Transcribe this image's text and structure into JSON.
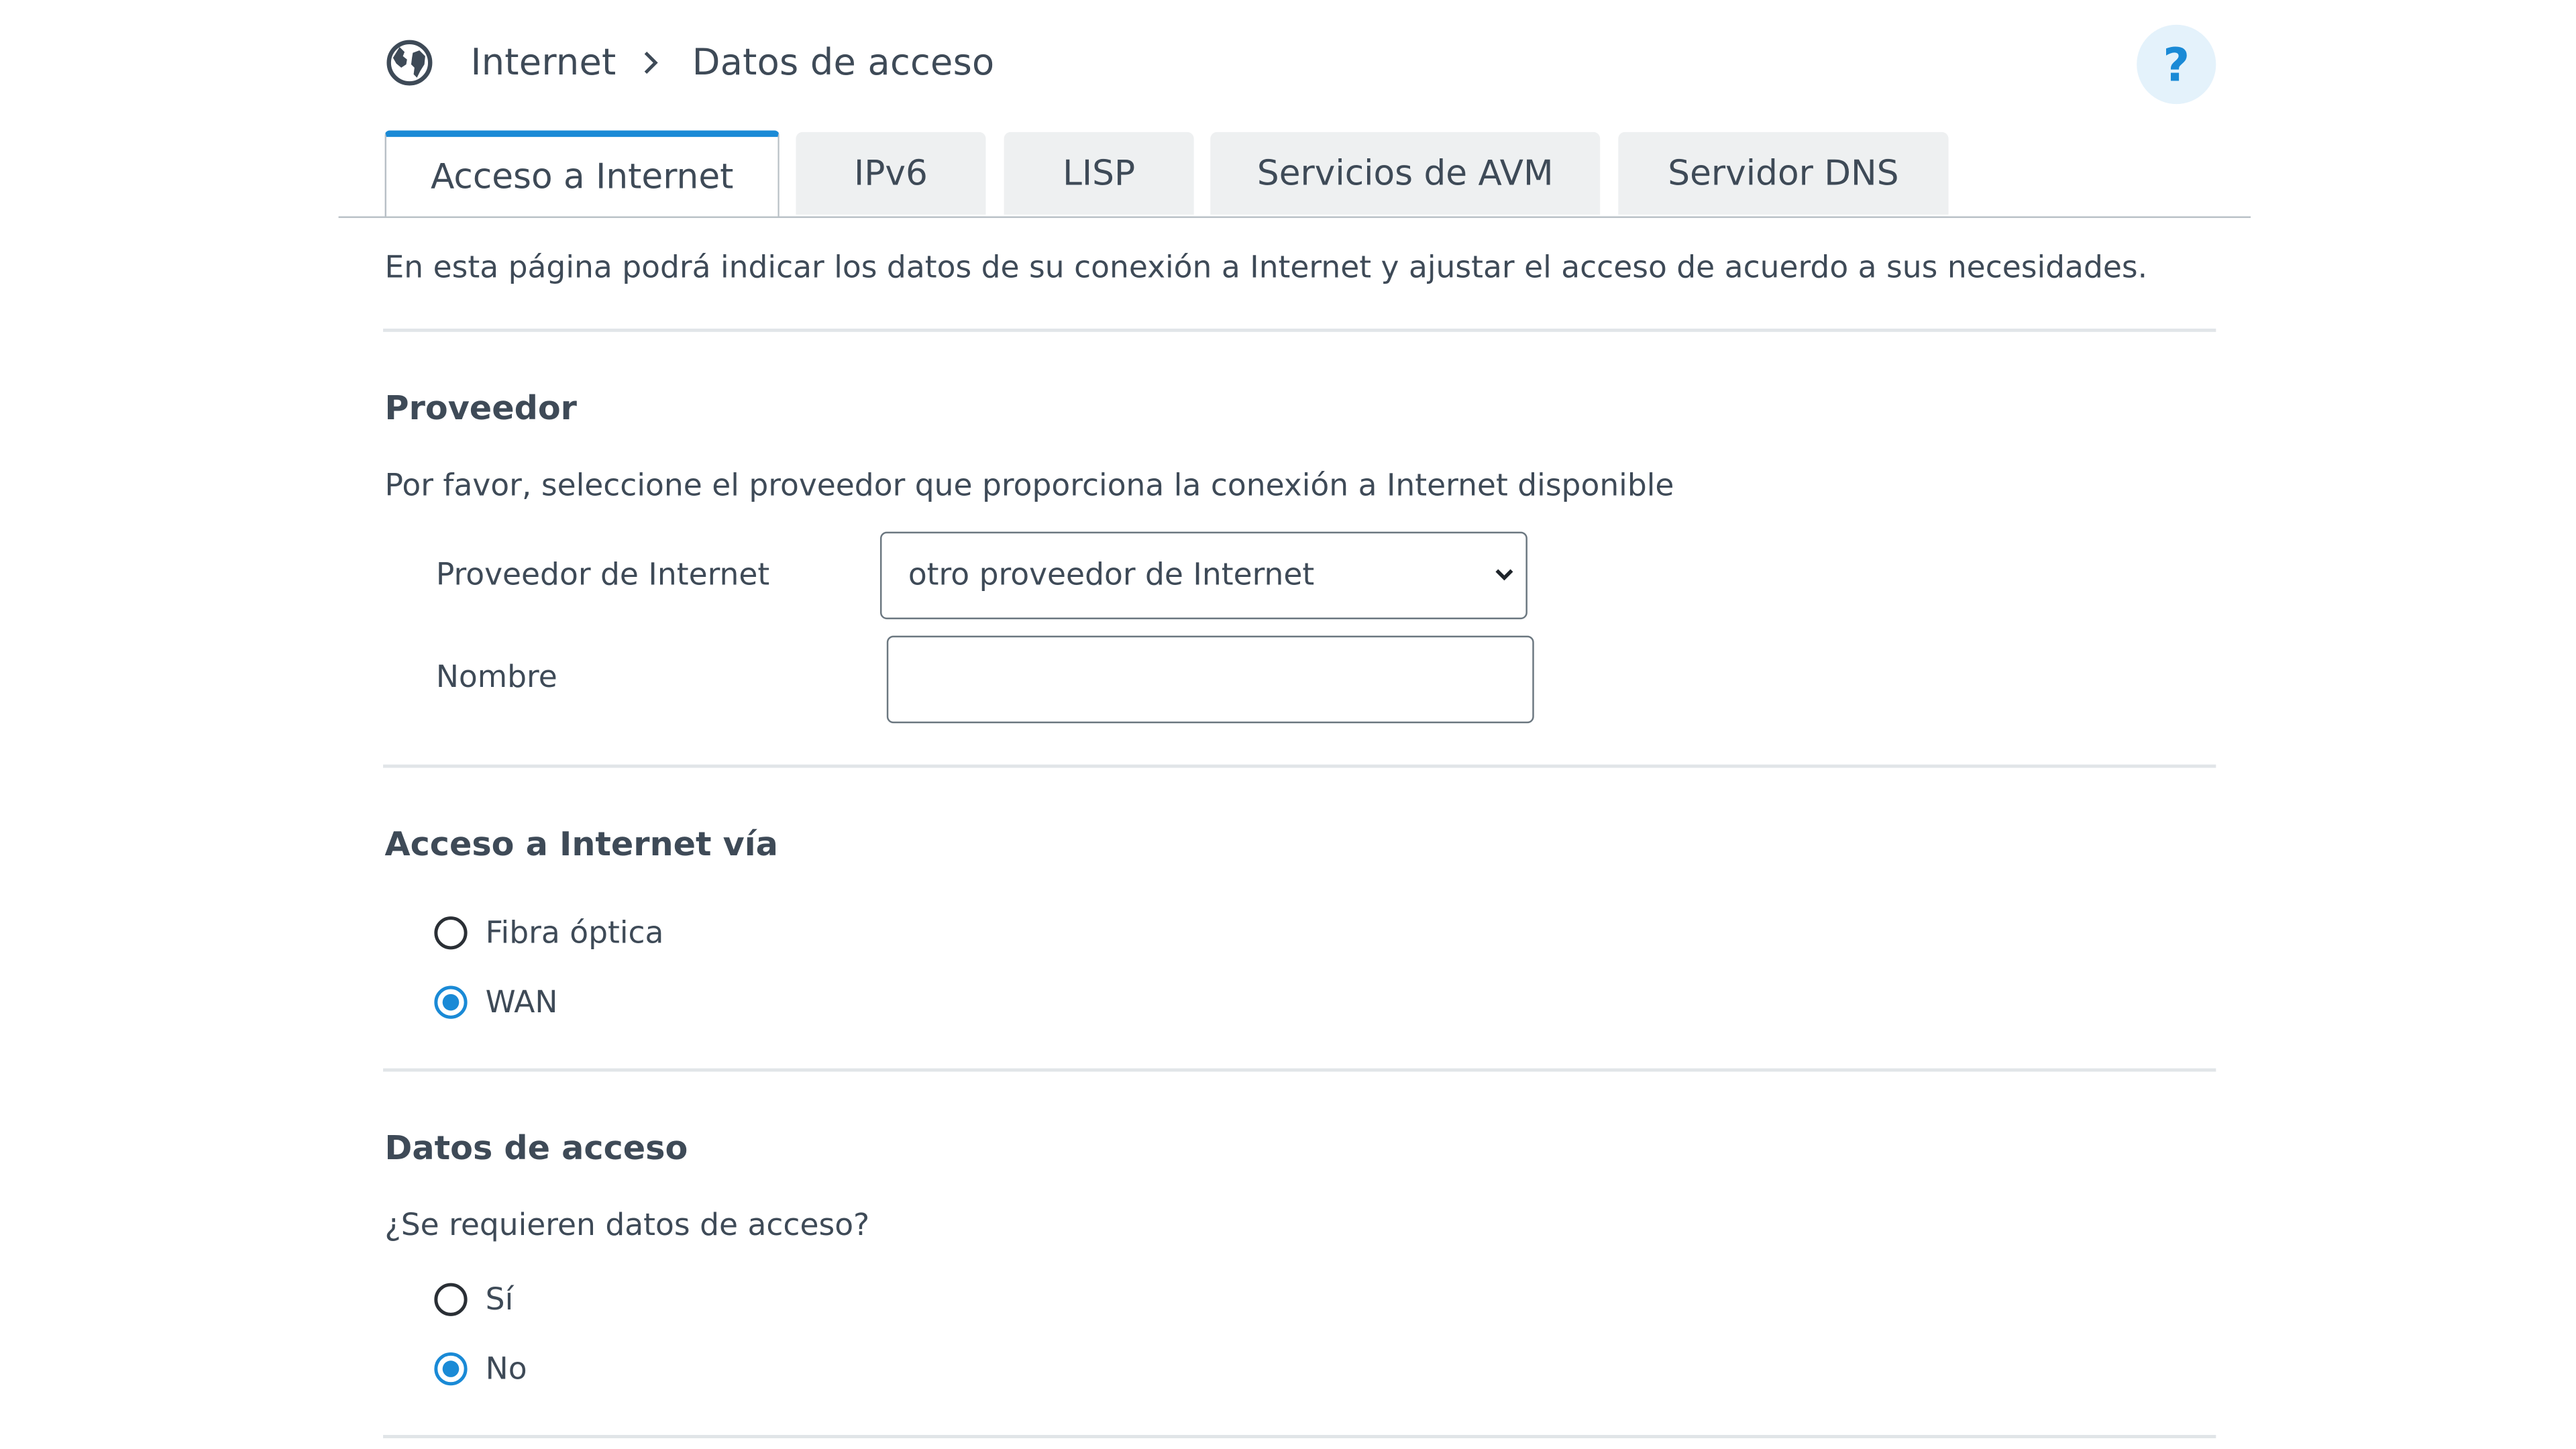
{
  "breadcrumb": {
    "icon": "globe-icon",
    "home": "Internet",
    "separator_icon": "chevron-right-icon",
    "current": "Datos de acceso"
  },
  "help": {
    "label": "?",
    "icon": "help-icon"
  },
  "tabs": [
    {
      "label": "Acceso a Internet",
      "active": true
    },
    {
      "label": "IPv6",
      "active": false
    },
    {
      "label": "LISP",
      "active": false
    },
    {
      "label": "Servicios de AVM",
      "active": false
    },
    {
      "label": "Servidor DNS",
      "active": false
    }
  ],
  "intro": "En esta página podrá indicar los datos de su conexión a Internet y ajustar el acceso de acuerdo a sus necesidades.",
  "provider_section": {
    "title": "Proveedor",
    "description": "Por favor, seleccione el proveedor que proporciona la conexión a Internet disponible",
    "provider_label": "Proveedor de Internet",
    "provider_value": "otro proveedor de Internet",
    "name_label": "Nombre",
    "name_value": ""
  },
  "access_section": {
    "title": "Acceso a Internet vía",
    "options": [
      {
        "label": "Fibra óptica",
        "checked": false
      },
      {
        "label": "WAN",
        "checked": true
      }
    ]
  },
  "credentials_section": {
    "title": "Datos de acceso",
    "question": "¿Se requieren datos de acceso?",
    "options": [
      {
        "label": "Sí",
        "checked": false
      },
      {
        "label": "No",
        "checked": true
      }
    ]
  },
  "colors": {
    "accent": "#1a8ad6",
    "text": "#3e4a57",
    "tab_inactive": "#eef0f1",
    "help_bg": "#e4f2fb"
  }
}
